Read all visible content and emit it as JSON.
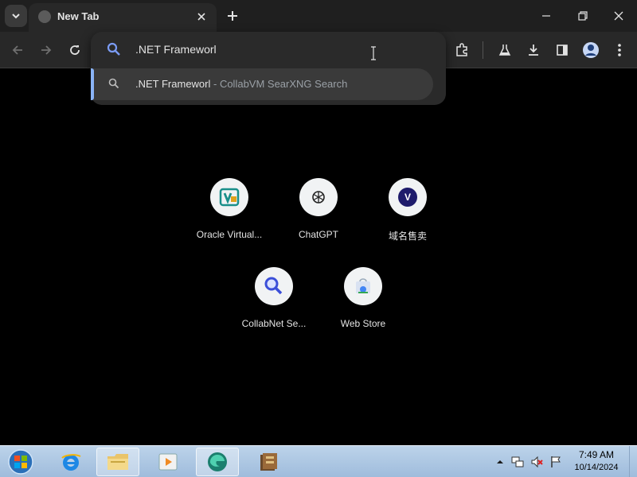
{
  "tab": {
    "title": "New Tab"
  },
  "omnibox": {
    "value": ".NET Frameworl"
  },
  "suggestion": {
    "primary": ".NET Frameworl",
    "secondary": " - CollabVM SearXNG Search"
  },
  "shortcuts": [
    {
      "label": "Oracle Virtual...",
      "icon": "virtualbox-icon"
    },
    {
      "label": "ChatGPT",
      "icon": "chatgpt-icon"
    },
    {
      "label": "域名售卖",
      "icon": "v-letter-icon",
      "letter": "V"
    },
    {
      "label": "CollabNet Se...",
      "icon": "magnifier-icon"
    },
    {
      "label": "Web Store",
      "icon": "web-store-icon"
    }
  ],
  "clock": {
    "time": "7:49 AM",
    "date": "10/14/2024"
  },
  "colors": {
    "accent": "#8ab4f8",
    "background": "#000000",
    "taskbar": "#bcd3ea"
  }
}
